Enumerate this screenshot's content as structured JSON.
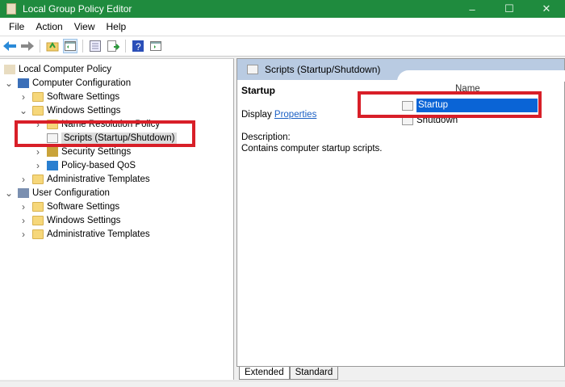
{
  "window": {
    "title": "Local Group Policy Editor",
    "controls": [
      "–",
      "☐",
      "✕"
    ]
  },
  "menu": [
    "File",
    "Action",
    "View",
    "Help"
  ],
  "toolbar": [
    "back-icon",
    "forward-icon",
    "up-folder-icon",
    "show-hide-tree-icon",
    "properties-icon",
    "export-list-icon",
    "help-icon",
    "action-pane-icon"
  ],
  "tree": [
    {
      "label": "Local Computer Policy",
      "level": 0,
      "chev": "",
      "icon": "policy"
    },
    {
      "label": "Computer Configuration",
      "level": 0,
      "chev": "v",
      "icon": "computer"
    },
    {
      "label": "Software Settings",
      "level": 1,
      "chev": ">",
      "icon": "folder"
    },
    {
      "label": "Windows Settings",
      "level": 1,
      "chev": "v",
      "icon": "folder"
    },
    {
      "label": "Name Resolution Policy",
      "level": 2,
      "chev": ">",
      "icon": "folder"
    },
    {
      "label": "Scripts (Startup/Shutdown)",
      "level": 2,
      "chev": "",
      "icon": "script",
      "selected": true
    },
    {
      "label": "Security Settings",
      "level": 2,
      "chev": ">",
      "icon": "security"
    },
    {
      "label": "Policy-based QoS",
      "level": 2,
      "chev": ">",
      "icon": "qos"
    },
    {
      "label": "Administrative Templates",
      "level": 1,
      "chev": ">",
      "icon": "folder"
    },
    {
      "label": "User Configuration",
      "level": 0,
      "chev": "v",
      "icon": "user"
    },
    {
      "label": "Software Settings",
      "level": 1,
      "chev": ">",
      "icon": "folder"
    },
    {
      "label": "Windows Settings",
      "level": 1,
      "chev": ">",
      "icon": "folder"
    },
    {
      "label": "Administrative Templates",
      "level": 1,
      "chev": ">",
      "icon": "folder"
    }
  ],
  "right": {
    "header": "Scripts (Startup/Shutdown)",
    "section": "Startup",
    "display_prefix": "Display ",
    "display_link": "Properties",
    "description_label": "Description:",
    "description": "Contains computer startup scripts.",
    "column_name": "Name",
    "items": [
      {
        "label": "Startup",
        "selected": true
      },
      {
        "label": "Shutdown"
      }
    ]
  },
  "tabs": [
    "Extended",
    "Standard"
  ],
  "colors": {
    "titlebar": "#1f8b3e",
    "highlight": "#0a64d6",
    "annotation": "#d81f28"
  }
}
